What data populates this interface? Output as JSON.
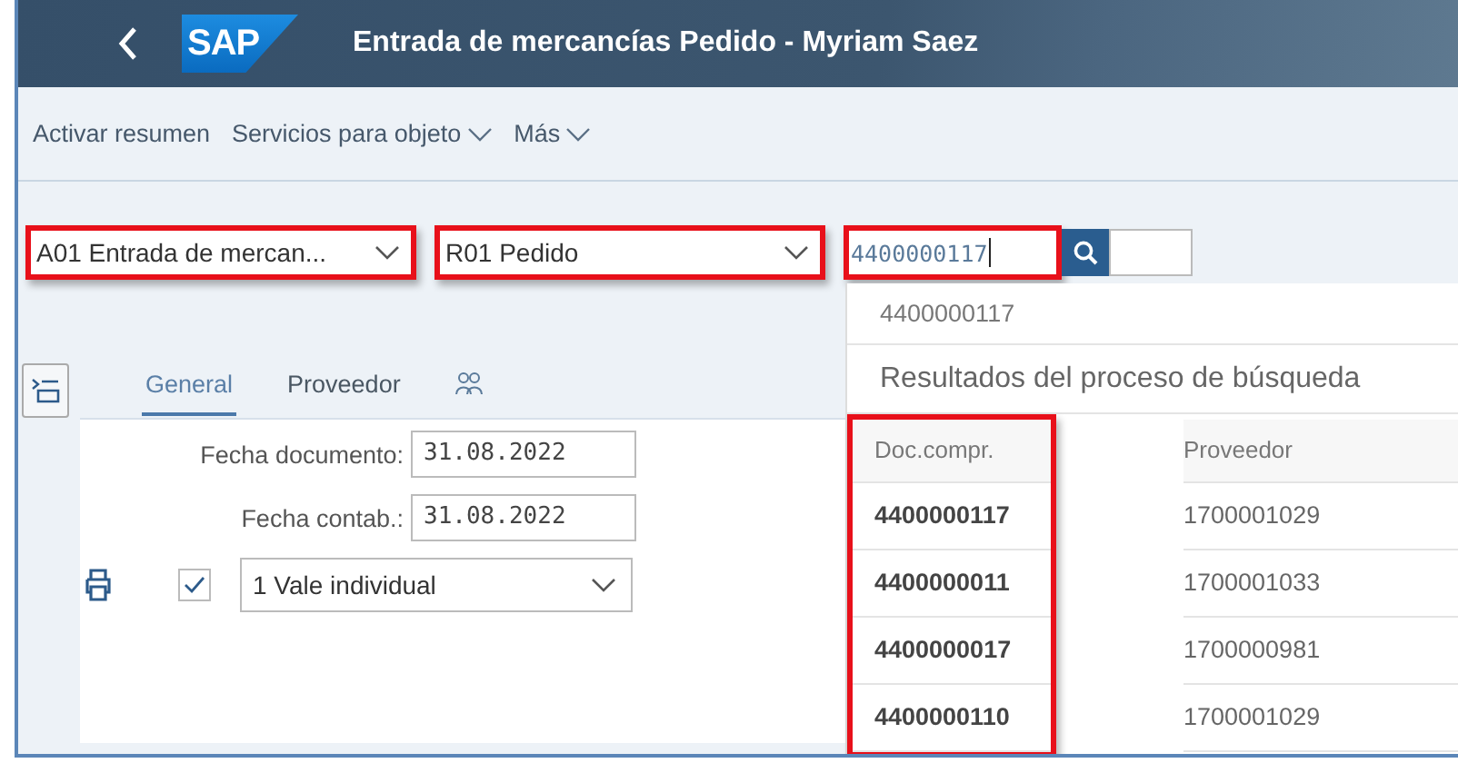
{
  "header": {
    "logo": "SAP",
    "title": "Entrada de mercancías Pedido - Myriam Saez"
  },
  "toolbar": [
    {
      "label": "Activar resumen",
      "menu": false
    },
    {
      "label": "Servicios para objeto",
      "menu": true
    },
    {
      "label": "Más",
      "menu": true
    }
  ],
  "selectors": [
    {
      "value": "A01 Entrada de mercan...",
      "highlighted": true
    },
    {
      "value": "R01 Pedido",
      "highlighted": true
    }
  ],
  "search": {
    "value": "4400000117",
    "highlighted": true
  },
  "tabs": [
    {
      "kind": "text",
      "label": "General",
      "selected": true
    },
    {
      "kind": "text",
      "label": "Proveedor",
      "selected": false
    },
    {
      "kind": "icon",
      "selected": false
    }
  ],
  "form": {
    "fields": [
      {
        "label": "Fecha documento:",
        "value": "31.08.2022"
      },
      {
        "label": "Fecha contab.:",
        "value": "31.08.2022"
      }
    ],
    "print": {
      "checked": true,
      "value": "1 Vale individual"
    }
  },
  "results": {
    "suggestion": "4400000117",
    "title": "Resultados del proceso de búsqueda",
    "columns": [
      {
        "label": "Doc.compr.",
        "highlighted": true,
        "bold": true
      },
      {
        "label": "Proveedor",
        "highlighted": false,
        "bold": false
      }
    ],
    "rows": [
      [
        "4400000117",
        "1700001029"
      ],
      [
        "4400000011",
        "1700001033"
      ],
      [
        "4400000017",
        "1700000981"
      ],
      [
        "4400000110",
        "1700001029"
      ]
    ]
  }
}
